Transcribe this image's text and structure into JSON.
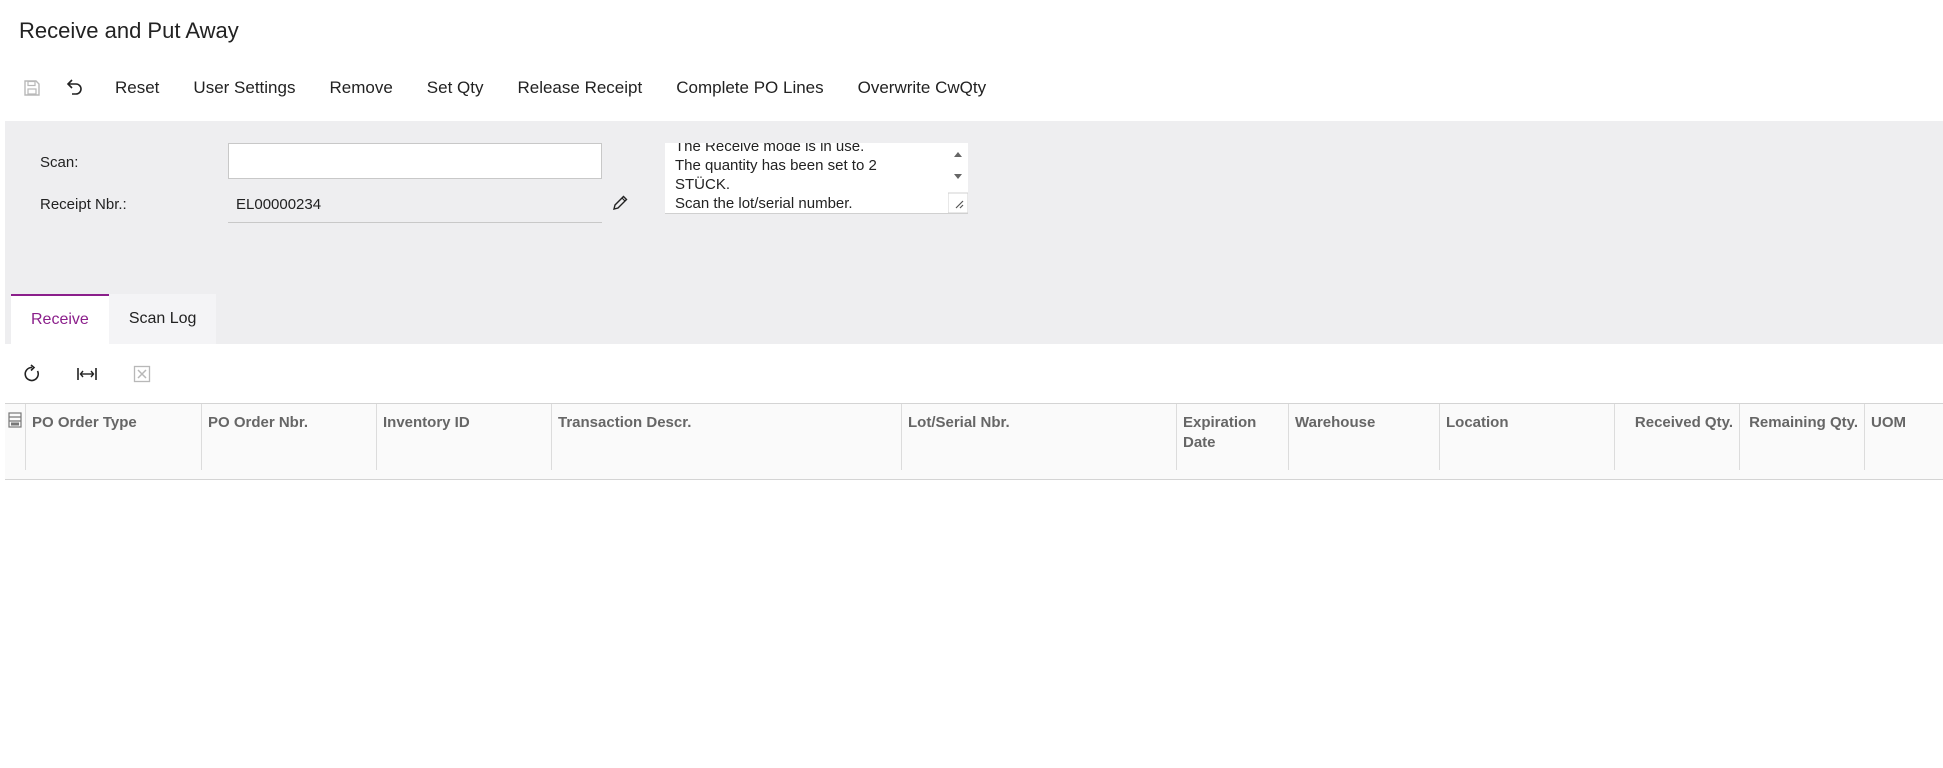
{
  "page": {
    "title": "Receive and Put Away"
  },
  "toolbar": {
    "icons": [
      "save-icon",
      "undo-icon"
    ],
    "buttons": [
      "Reset",
      "User Settings",
      "Remove",
      "Set Qty",
      "Release Receipt",
      "Complete PO Lines",
      "Overwrite CwQty"
    ]
  },
  "form": {
    "scan_label": "Scan:",
    "scan_value": "",
    "receipt_label": "Receipt Nbr.:",
    "receipt_value": "EL00000234",
    "messages": [
      "The Receive mode is in use.",
      "The quantity has been set to 2",
      "STÜCK.",
      "Scan the lot/serial number."
    ]
  },
  "tabs": [
    {
      "label": "Receive",
      "active": true
    },
    {
      "label": "Scan Log",
      "active": false
    }
  ],
  "grid_tools": [
    "refresh-icon",
    "fit-columns-icon",
    "export-excel-icon"
  ],
  "grid": {
    "columns": [
      "PO Order Type",
      "PO Order Nbr.",
      "Inventory ID",
      "Transaction Descr.",
      "Lot/Serial Nbr.",
      "Expiration Date",
      "Warehouse",
      "Location",
      "Received Qty.",
      "Remaining Qty.",
      "UOM"
    ],
    "rows": []
  },
  "colors": {
    "accent": "#8b1f8b",
    "form_bg": "#eeeef0"
  }
}
